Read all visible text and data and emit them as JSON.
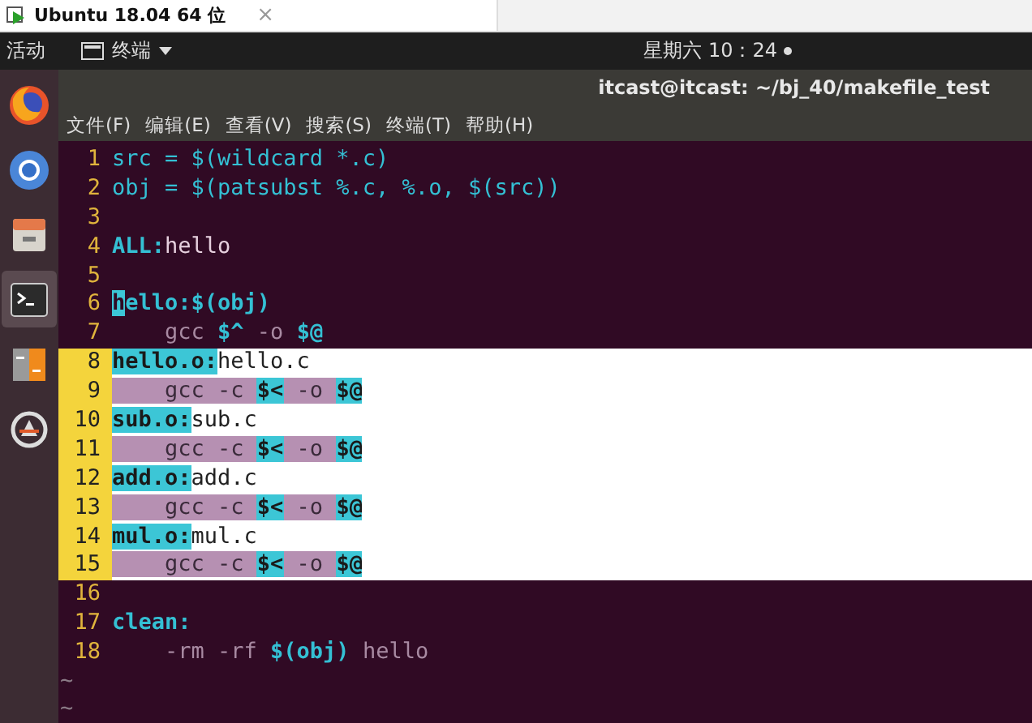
{
  "vm_tab": {
    "title": "Ubuntu 18.04 64 位",
    "close": "×"
  },
  "top_bar": {
    "activities": "活动",
    "app_menu": "终端",
    "clock": "星期六 10：24"
  },
  "dock": {
    "items": [
      {
        "kind": "firefox",
        "selected": false
      },
      {
        "kind": "chromium",
        "selected": false
      },
      {
        "kind": "files",
        "selected": false
      },
      {
        "kind": "terminal",
        "selected": true
      },
      {
        "kind": "settings",
        "selected": false
      },
      {
        "kind": "updater",
        "selected": false
      }
    ]
  },
  "terminal": {
    "title": "itcast@itcast: ~/bj_40/makefile_test",
    "menu": [
      "文件(F)",
      "编辑(E)",
      "查看(V)",
      "搜索(S)",
      "终端(T)",
      "帮助(H)"
    ],
    "lines": [
      {
        "number": "1",
        "selected": false,
        "segments": [
          {
            "kind": "code",
            "text": "src = $(wildcard *.c)"
          }
        ]
      },
      {
        "number": "2",
        "selected": false,
        "segments": [
          {
            "kind": "code",
            "text": "obj = $(patsubst %.c, %.o, $(src))"
          }
        ]
      },
      {
        "number": "3",
        "selected": false
      },
      {
        "number": "4",
        "selected": false,
        "segments": [
          {
            "kind": "target",
            "text": "ALL:"
          },
          {
            "kind": "text",
            "text": "hello"
          }
        ]
      },
      {
        "number": "5",
        "selected": false
      },
      {
        "number": "6",
        "selected": false,
        "segments": [
          {
            "kind": "cursor",
            "text": "h"
          },
          {
            "kind": "target",
            "text": "ello:$(obj)"
          }
        ]
      },
      {
        "number": "7",
        "selected": false,
        "segments": [
          {
            "kind": "cmd",
            "text": "    gcc "
          },
          {
            "kind": "var",
            "text": "$^"
          },
          {
            "kind": "cmd",
            "text": " -o "
          },
          {
            "kind": "var",
            "text": "$@"
          }
        ]
      },
      {
        "number": "8",
        "selected": true,
        "segments": [
          {
            "kind": "target",
            "text": "hello.o:"
          },
          {
            "kind": "text",
            "text": "hello.c"
          }
        ]
      },
      {
        "number": "9",
        "selected": true,
        "segments": [
          {
            "kind": "cmd",
            "text": "    gcc -c "
          },
          {
            "kind": "var",
            "text": "$<"
          },
          {
            "kind": "cmd",
            "text": " -o "
          },
          {
            "kind": "var",
            "text": "$@"
          }
        ]
      },
      {
        "number": "10",
        "selected": true,
        "segments": [
          {
            "kind": "target",
            "text": "sub.o:"
          },
          {
            "kind": "text",
            "text": "sub.c"
          }
        ]
      },
      {
        "number": "11",
        "selected": true,
        "segments": [
          {
            "kind": "cmd",
            "text": "    gcc -c "
          },
          {
            "kind": "var",
            "text": "$<"
          },
          {
            "kind": "cmd",
            "text": " -o "
          },
          {
            "kind": "var",
            "text": "$@"
          }
        ]
      },
      {
        "number": "12",
        "selected": true,
        "segments": [
          {
            "kind": "target",
            "text": "add.o:"
          },
          {
            "kind": "text",
            "text": "add.c"
          }
        ]
      },
      {
        "number": "13",
        "selected": true,
        "segments": [
          {
            "kind": "cmd",
            "text": "    gcc -c "
          },
          {
            "kind": "var",
            "text": "$<"
          },
          {
            "kind": "cmd",
            "text": " -o "
          },
          {
            "kind": "var",
            "text": "$@"
          }
        ]
      },
      {
        "number": "14",
        "selected": true,
        "segments": [
          {
            "kind": "target",
            "text": "mul.o:"
          },
          {
            "kind": "text",
            "text": "mul.c"
          }
        ]
      },
      {
        "number": "15",
        "selected": true,
        "segments": [
          {
            "kind": "cmd",
            "text": "    gcc -c "
          },
          {
            "kind": "var",
            "text": "$<"
          },
          {
            "kind": "cmd",
            "text": " -o "
          },
          {
            "kind": "var",
            "text": "$@"
          }
        ]
      },
      {
        "number": "16",
        "selected": false
      },
      {
        "number": "17",
        "selected": false,
        "segments": [
          {
            "kind": "target",
            "text": "clean:"
          }
        ]
      },
      {
        "number": "18",
        "selected": false,
        "segments": [
          {
            "kind": "cmd",
            "text": "    -rm -rf "
          },
          {
            "kind": "var",
            "text": "$(obj)"
          },
          {
            "kind": "cmd",
            "text": " hello"
          }
        ]
      }
    ],
    "tildes": [
      "~",
      "~"
    ]
  }
}
